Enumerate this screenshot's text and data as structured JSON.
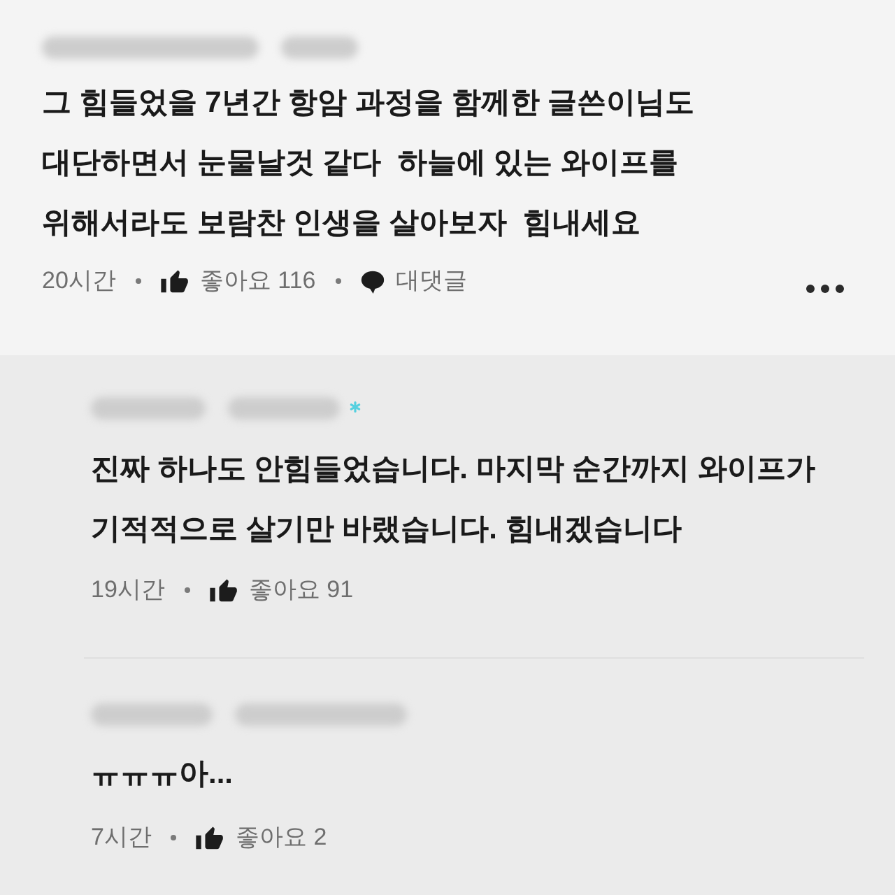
{
  "comment": {
    "text_lines": [
      "그 힘들었을 7년간 항암 과정을 함께한 글쓴이님도",
      "대단하면서 눈물날것 같다  하늘에 있는 와이프를",
      "위해서라도 보람찬 인생을 살아보자  힘내세요"
    ],
    "time": "20시간",
    "likes": "좋아요 116",
    "reply_button": "대댓글"
  },
  "replies": [
    {
      "author_mark": true,
      "text_lines": [
        "진짜 하나도 안힘들었습니다. 마지막 순간까지 와이프가",
        "기적적으로 살기만 바랬습니다. 힘내겠습니다"
      ],
      "time": "19시간",
      "likes": "좋아요 91"
    },
    {
      "author_mark": false,
      "text_lines": [
        "ㅠㅠㅠ아..."
      ],
      "time": "7시간",
      "likes": "좋아요 2"
    }
  ]
}
